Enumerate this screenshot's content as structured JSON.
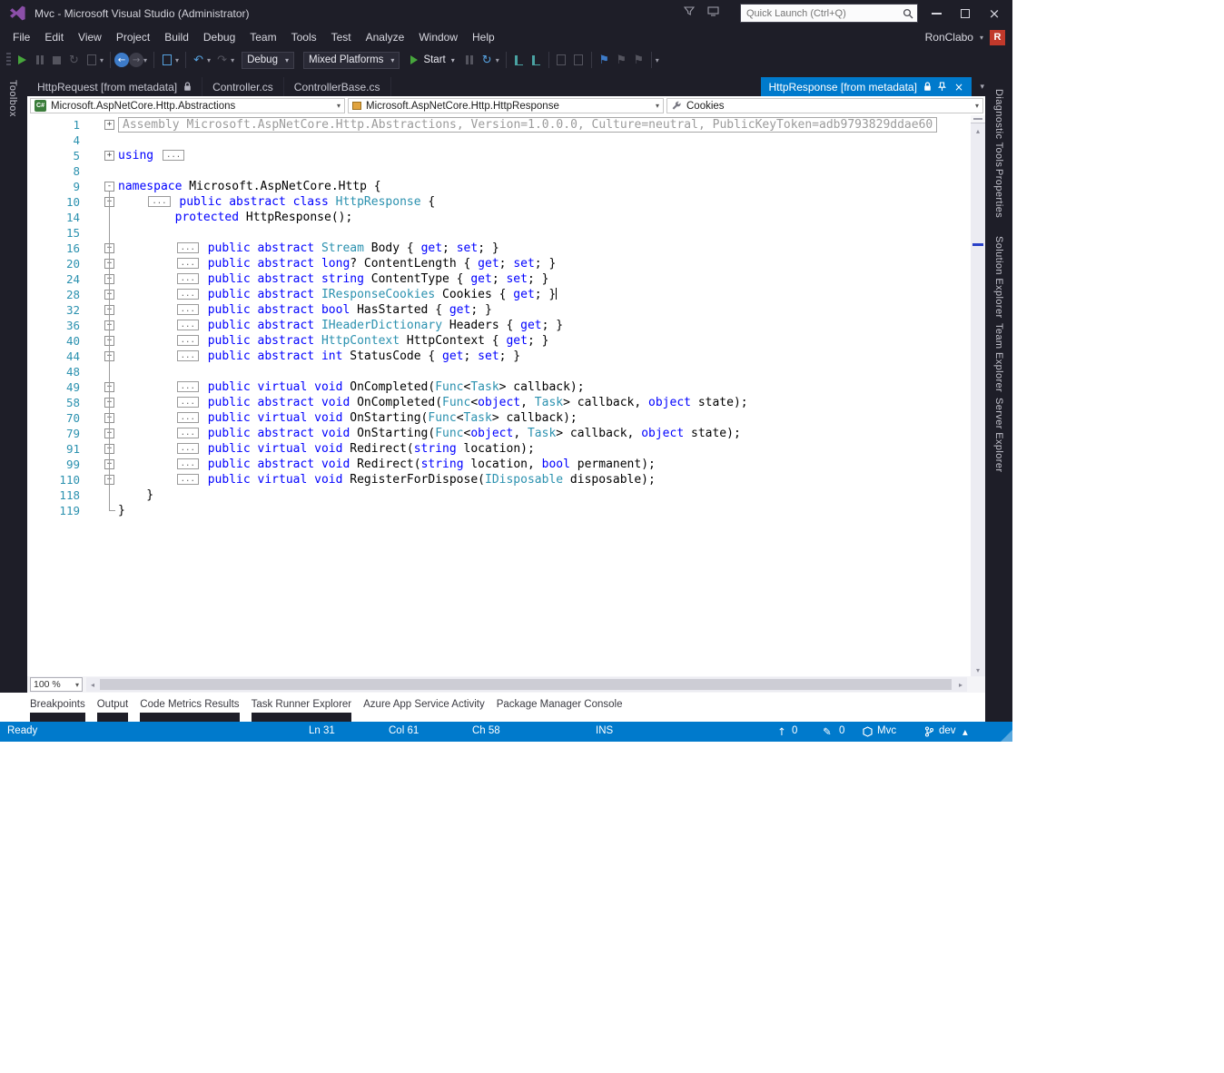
{
  "window": {
    "title": "Mvc - Microsoft Visual Studio (Administrator)"
  },
  "titlebar": {
    "quick_launch": "Quick Launch (Ctrl+Q)"
  },
  "menubar": {
    "items": [
      "File",
      "Edit",
      "View",
      "Project",
      "Build",
      "Debug",
      "Team",
      "Tools",
      "Test",
      "Analyze",
      "Window",
      "Help"
    ],
    "user": "RonClabo",
    "avatar": "R"
  },
  "toolbar": {
    "debug_config": "Debug",
    "platform": "Mixed Platforms",
    "start_label": "Start"
  },
  "docwell": {
    "tabs": [
      {
        "label": "HttpRequest [from metadata]",
        "locked": true
      },
      {
        "label": "Controller.cs",
        "locked": false
      },
      {
        "label": "ControllerBase.cs",
        "locked": false
      }
    ],
    "active_tab": {
      "label": "HttpResponse [from metadata]"
    }
  },
  "navbar": {
    "project": "Microsoft.AspNetCore.Http.Abstractions",
    "type": "Microsoft.AspNetCore.Http.HttpResponse",
    "member": "Cookies"
  },
  "editor": {
    "lines": [
      {
        "n": "1",
        "f": "+",
        "seg": [
          [
            "a",
            "Assembly Microsoft.AspNetCore.Http.Abstractions, Version=1.0.0.0, Culture=neutral, PublicKeyToken=adb9793829ddae60"
          ]
        ]
      },
      {
        "n": "4",
        "seg": []
      },
      {
        "n": "5",
        "f": "+",
        "seg": [
          [
            "k",
            "using"
          ],
          [
            "p",
            " "
          ],
          [
            "b",
            "..."
          ]
        ]
      },
      {
        "n": "8",
        "seg": []
      },
      {
        "n": "9",
        "f": "-",
        "seg": [
          [
            "k",
            "namespace"
          ],
          [
            "p",
            " Microsoft.AspNetCore.Http {"
          ]
        ]
      },
      {
        "n": "10",
        "f": "+",
        "seg": [
          [
            "p",
            "    "
          ],
          [
            "b",
            "..."
          ],
          [
            "p",
            " "
          ],
          [
            "k",
            "public"
          ],
          [
            "p",
            " "
          ],
          [
            "k",
            "abstract"
          ],
          [
            "p",
            " "
          ],
          [
            "k",
            "class"
          ],
          [
            "p",
            " "
          ],
          [
            "t",
            "HttpResponse"
          ],
          [
            "p",
            " {"
          ]
        ]
      },
      {
        "n": "14",
        "seg": [
          [
            "p",
            "        "
          ],
          [
            "k",
            "protected"
          ],
          [
            "p",
            " HttpResponse();"
          ]
        ]
      },
      {
        "n": "15",
        "seg": []
      },
      {
        "n": "16",
        "f": "+",
        "seg": [
          [
            "p",
            "        "
          ],
          [
            "b",
            "..."
          ],
          [
            "p",
            " "
          ],
          [
            "k",
            "public"
          ],
          [
            "p",
            " "
          ],
          [
            "k",
            "abstract"
          ],
          [
            "p",
            " "
          ],
          [
            "t",
            "Stream"
          ],
          [
            "p",
            " Body { "
          ],
          [
            "k",
            "get"
          ],
          [
            "p",
            "; "
          ],
          [
            "k",
            "set"
          ],
          [
            "p",
            "; }"
          ]
        ]
      },
      {
        "n": "20",
        "f": "+",
        "seg": [
          [
            "p",
            "        "
          ],
          [
            "b",
            "..."
          ],
          [
            "p",
            " "
          ],
          [
            "k",
            "public"
          ],
          [
            "p",
            " "
          ],
          [
            "k",
            "abstract"
          ],
          [
            "p",
            " "
          ],
          [
            "k",
            "long"
          ],
          [
            "p",
            "? ContentLength { "
          ],
          [
            "k",
            "get"
          ],
          [
            "p",
            "; "
          ],
          [
            "k",
            "set"
          ],
          [
            "p",
            "; }"
          ]
        ]
      },
      {
        "n": "24",
        "f": "+",
        "seg": [
          [
            "p",
            "        "
          ],
          [
            "b",
            "..."
          ],
          [
            "p",
            " "
          ],
          [
            "k",
            "public"
          ],
          [
            "p",
            " "
          ],
          [
            "k",
            "abstract"
          ],
          [
            "p",
            " "
          ],
          [
            "k",
            "string"
          ],
          [
            "p",
            " ContentType { "
          ],
          [
            "k",
            "get"
          ],
          [
            "p",
            "; "
          ],
          [
            "k",
            "set"
          ],
          [
            "p",
            "; }"
          ]
        ]
      },
      {
        "n": "28",
        "f": "+",
        "seg": [
          [
            "p",
            "        "
          ],
          [
            "b",
            "..."
          ],
          [
            "p",
            " "
          ],
          [
            "k",
            "public"
          ],
          [
            "p",
            " "
          ],
          [
            "k",
            "abstract"
          ],
          [
            "p",
            " "
          ],
          [
            "t",
            "IResponseCookies"
          ],
          [
            "p",
            " Cookies { "
          ],
          [
            "k",
            "get"
          ],
          [
            "p",
            "; }"
          ],
          [
            "c",
            ""
          ]
        ]
      },
      {
        "n": "32",
        "f": "+",
        "seg": [
          [
            "p",
            "        "
          ],
          [
            "b",
            "..."
          ],
          [
            "p",
            " "
          ],
          [
            "k",
            "public"
          ],
          [
            "p",
            " "
          ],
          [
            "k",
            "abstract"
          ],
          [
            "p",
            " "
          ],
          [
            "k",
            "bool"
          ],
          [
            "p",
            " HasStarted { "
          ],
          [
            "k",
            "get"
          ],
          [
            "p",
            "; }"
          ]
        ]
      },
      {
        "n": "36",
        "f": "+",
        "seg": [
          [
            "p",
            "        "
          ],
          [
            "b",
            "..."
          ],
          [
            "p",
            " "
          ],
          [
            "k",
            "public"
          ],
          [
            "p",
            " "
          ],
          [
            "k",
            "abstract"
          ],
          [
            "p",
            " "
          ],
          [
            "t",
            "IHeaderDictionary"
          ],
          [
            "p",
            " Headers { "
          ],
          [
            "k",
            "get"
          ],
          [
            "p",
            "; }"
          ]
        ]
      },
      {
        "n": "40",
        "f": "+",
        "seg": [
          [
            "p",
            "        "
          ],
          [
            "b",
            "..."
          ],
          [
            "p",
            " "
          ],
          [
            "k",
            "public"
          ],
          [
            "p",
            " "
          ],
          [
            "k",
            "abstract"
          ],
          [
            "p",
            " "
          ],
          [
            "t",
            "HttpContext"
          ],
          [
            "p",
            " HttpContext { "
          ],
          [
            "k",
            "get"
          ],
          [
            "p",
            "; }"
          ]
        ]
      },
      {
        "n": "44",
        "f": "+",
        "seg": [
          [
            "p",
            "        "
          ],
          [
            "b",
            "..."
          ],
          [
            "p",
            " "
          ],
          [
            "k",
            "public"
          ],
          [
            "p",
            " "
          ],
          [
            "k",
            "abstract"
          ],
          [
            "p",
            " "
          ],
          [
            "k",
            "int"
          ],
          [
            "p",
            " StatusCode { "
          ],
          [
            "k",
            "get"
          ],
          [
            "p",
            "; "
          ],
          [
            "k",
            "set"
          ],
          [
            "p",
            "; }"
          ]
        ]
      },
      {
        "n": "48",
        "seg": []
      },
      {
        "n": "49",
        "f": "+",
        "seg": [
          [
            "p",
            "        "
          ],
          [
            "b",
            "..."
          ],
          [
            "p",
            " "
          ],
          [
            "k",
            "public"
          ],
          [
            "p",
            " "
          ],
          [
            "k",
            "virtual"
          ],
          [
            "p",
            " "
          ],
          [
            "k",
            "void"
          ],
          [
            "p",
            " OnCompleted("
          ],
          [
            "t",
            "Func"
          ],
          [
            "p",
            "<"
          ],
          [
            "t",
            "Task"
          ],
          [
            "p",
            "> callback);"
          ]
        ]
      },
      {
        "n": "58",
        "f": "+",
        "seg": [
          [
            "p",
            "        "
          ],
          [
            "b",
            "..."
          ],
          [
            "p",
            " "
          ],
          [
            "k",
            "public"
          ],
          [
            "p",
            " "
          ],
          [
            "k",
            "abstract"
          ],
          [
            "p",
            " "
          ],
          [
            "k",
            "void"
          ],
          [
            "p",
            " OnCompleted("
          ],
          [
            "t",
            "Func"
          ],
          [
            "p",
            "<"
          ],
          [
            "k",
            "object"
          ],
          [
            "p",
            ", "
          ],
          [
            "t",
            "Task"
          ],
          [
            "p",
            "> callback, "
          ],
          [
            "k",
            "object"
          ],
          [
            "p",
            " state);"
          ]
        ]
      },
      {
        "n": "70",
        "f": "+",
        "seg": [
          [
            "p",
            "        "
          ],
          [
            "b",
            "..."
          ],
          [
            "p",
            " "
          ],
          [
            "k",
            "public"
          ],
          [
            "p",
            " "
          ],
          [
            "k",
            "virtual"
          ],
          [
            "p",
            " "
          ],
          [
            "k",
            "void"
          ],
          [
            "p",
            " OnStarting("
          ],
          [
            "t",
            "Func"
          ],
          [
            "p",
            "<"
          ],
          [
            "t",
            "Task"
          ],
          [
            "p",
            "> callback);"
          ]
        ]
      },
      {
        "n": "79",
        "f": "+",
        "seg": [
          [
            "p",
            "        "
          ],
          [
            "b",
            "..."
          ],
          [
            "p",
            " "
          ],
          [
            "k",
            "public"
          ],
          [
            "p",
            " "
          ],
          [
            "k",
            "abstract"
          ],
          [
            "p",
            " "
          ],
          [
            "k",
            "void"
          ],
          [
            "p",
            " OnStarting("
          ],
          [
            "t",
            "Func"
          ],
          [
            "p",
            "<"
          ],
          [
            "k",
            "object"
          ],
          [
            "p",
            ", "
          ],
          [
            "t",
            "Task"
          ],
          [
            "p",
            "> callback, "
          ],
          [
            "k",
            "object"
          ],
          [
            "p",
            " state);"
          ]
        ]
      },
      {
        "n": "91",
        "f": "+",
        "seg": [
          [
            "p",
            "        "
          ],
          [
            "b",
            "..."
          ],
          [
            "p",
            " "
          ],
          [
            "k",
            "public"
          ],
          [
            "p",
            " "
          ],
          [
            "k",
            "virtual"
          ],
          [
            "p",
            " "
          ],
          [
            "k",
            "void"
          ],
          [
            "p",
            " Redirect("
          ],
          [
            "k",
            "string"
          ],
          [
            "p",
            " location);"
          ]
        ]
      },
      {
        "n": "99",
        "f": "+",
        "seg": [
          [
            "p",
            "        "
          ],
          [
            "b",
            "..."
          ],
          [
            "p",
            " "
          ],
          [
            "k",
            "public"
          ],
          [
            "p",
            " "
          ],
          [
            "k",
            "abstract"
          ],
          [
            "p",
            " "
          ],
          [
            "k",
            "void"
          ],
          [
            "p",
            " Redirect("
          ],
          [
            "k",
            "string"
          ],
          [
            "p",
            " location, "
          ],
          [
            "k",
            "bool"
          ],
          [
            "p",
            " permanent);"
          ]
        ]
      },
      {
        "n": "110",
        "f": "+",
        "seg": [
          [
            "p",
            "        "
          ],
          [
            "b",
            "..."
          ],
          [
            "p",
            " "
          ],
          [
            "k",
            "public"
          ],
          [
            "p",
            " "
          ],
          [
            "k",
            "virtual"
          ],
          [
            "p",
            " "
          ],
          [
            "k",
            "void"
          ],
          [
            "p",
            " RegisterForDispose("
          ],
          [
            "t",
            "IDisposable"
          ],
          [
            "p",
            " disposable);"
          ]
        ]
      },
      {
        "n": "118",
        "seg": [
          [
            "p",
            "    }"
          ]
        ]
      },
      {
        "n": "119",
        "seg": [
          [
            "p",
            "}"
          ]
        ]
      }
    ]
  },
  "zoom": {
    "value": "100 %"
  },
  "panel": {
    "tabs": [
      {
        "label": "Breakpoints",
        "block": true
      },
      {
        "label": "Output",
        "block": true
      },
      {
        "label": "Code Metrics Results",
        "block": true
      },
      {
        "label": "Task Runner Explorer",
        "block": true
      },
      {
        "label": "Azure App Service Activity",
        "block": false
      },
      {
        "label": "Package Manager Console",
        "block": false
      }
    ]
  },
  "statusbar": {
    "state": "Ready",
    "ln": "Ln 31",
    "col": "Col 61",
    "ch": "Ch 58",
    "mode": "INS",
    "pushes": "0",
    "edits": "0",
    "repo": "Mvc",
    "branch": "dev"
  },
  "side": {
    "left": [
      "Toolbox"
    ],
    "right": [
      "Diagnostic Tools",
      "Properties",
      "Solution Explorer",
      "Team Explorer",
      "Server Explorer"
    ]
  },
  "icons": {
    "caret_down": "▾",
    "caret_up": "▴",
    "close": "×",
    "undo": "↶",
    "redo": "↷",
    "refresh": "↻",
    "back": "←",
    "forward": "→",
    "bookmark": "⚑",
    "up_arrow": "↑",
    "pencil": "✎",
    "scroll_up": "▴",
    "scroll_down": "▾",
    "scroll_left": "◂",
    "scroll_right": "▸"
  },
  "colors": {
    "chrome": "#1e1e28",
    "accent": "#007acc",
    "keyword": "#0000ff",
    "type": "#2b91af",
    "line_number": "#2b91af",
    "metadata_gray": "#9b9b9b"
  }
}
